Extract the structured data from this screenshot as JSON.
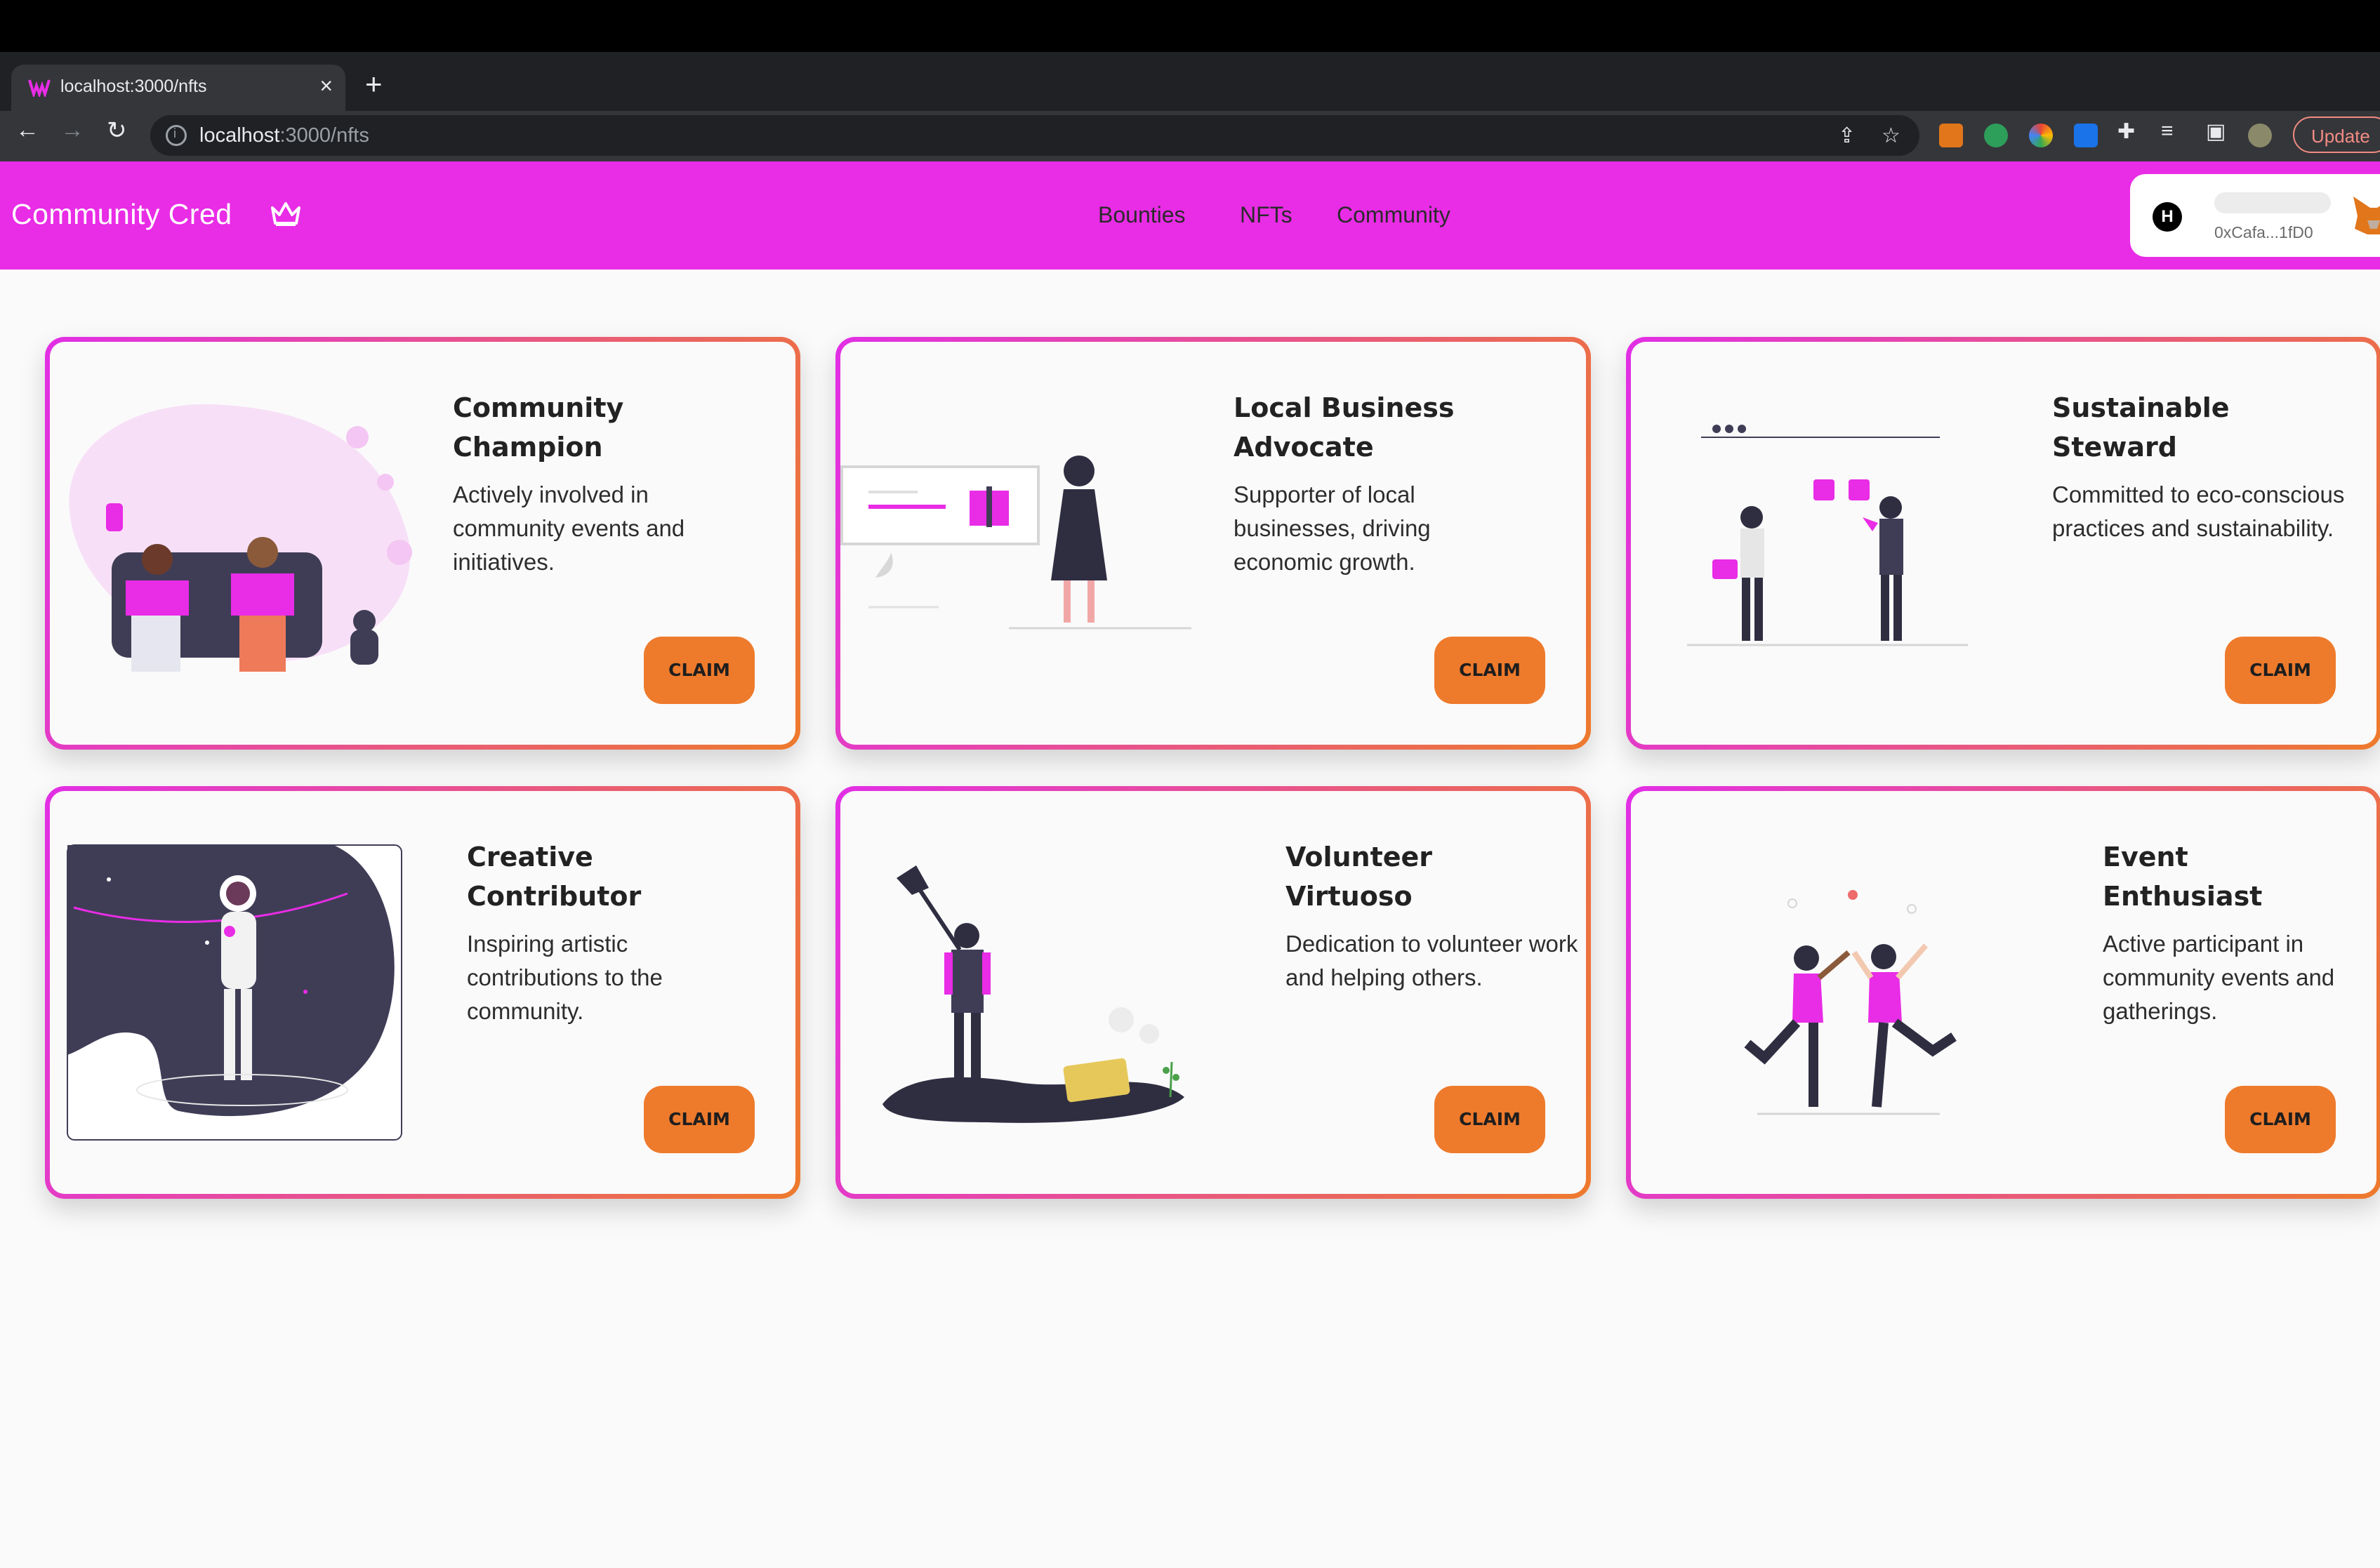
{
  "browser": {
    "tab_title": "localhost:3000/nfts",
    "close_glyph": "×",
    "new_tab_glyph": "+",
    "url_host": "localhost",
    "url_path": ":3000/nfts",
    "update_label": "Update"
  },
  "header": {
    "brand": "Community Cred",
    "nav": [
      "Bounties",
      "NFTs",
      "Community"
    ],
    "wallet_address": "0xCafa...1fD0",
    "wallet_avatar_letter": "H"
  },
  "cards": [
    {
      "title": "Community Champion",
      "description": "Actively involved in community events and initiatives.",
      "button": "CLAIM"
    },
    {
      "title": "Local Business Advocate",
      "description": "Supporter of local businesses, driving economic growth.",
      "button": "CLAIM"
    },
    {
      "title": "Sustainable Steward",
      "description": "Committed to eco-conscious practices and sustainability.",
      "button": "CLAIM"
    },
    {
      "title": "Creative Contributor",
      "description": "Inspiring artistic contributions to the community.",
      "button": "CLAIM"
    },
    {
      "title": "Volunteer Virtuoso",
      "description": "Dedication to volunteer work and helping others.",
      "button": "CLAIM"
    },
    {
      "title": "Event Enthusiast",
      "description": "Active participant in community events and gatherings.",
      "button": "CLAIM"
    }
  ],
  "colors": {
    "header": "#e92ce6",
    "accent_orange": "#ee7a2c",
    "accent_pink": "#e22ee6",
    "page_bg": "#fafafa"
  }
}
